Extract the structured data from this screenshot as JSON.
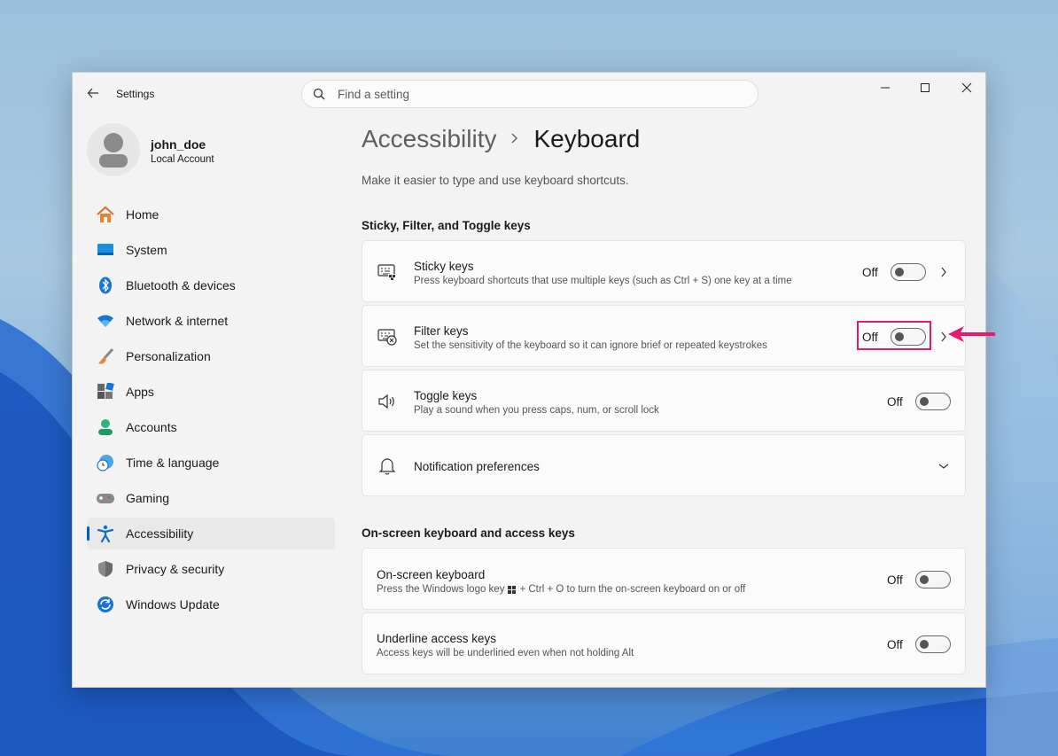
{
  "window": {
    "title": "Settings",
    "search_placeholder": "Find a setting"
  },
  "profile": {
    "name": "john_doe",
    "account_type": "Local Account"
  },
  "sidebar": {
    "items": [
      {
        "label": "Home",
        "icon": "home-icon"
      },
      {
        "label": "System",
        "icon": "system-icon"
      },
      {
        "label": "Bluetooth & devices",
        "icon": "bluetooth-icon"
      },
      {
        "label": "Network & internet",
        "icon": "wifi-icon"
      },
      {
        "label": "Personalization",
        "icon": "brush-icon"
      },
      {
        "label": "Apps",
        "icon": "apps-icon"
      },
      {
        "label": "Accounts",
        "icon": "accounts-icon"
      },
      {
        "label": "Time & language",
        "icon": "globe-clock-icon"
      },
      {
        "label": "Gaming",
        "icon": "gamepad-icon"
      },
      {
        "label": "Accessibility",
        "icon": "accessibility-icon",
        "active": true
      },
      {
        "label": "Privacy & security",
        "icon": "shield-icon"
      },
      {
        "label": "Windows Update",
        "icon": "update-icon"
      }
    ]
  },
  "page": {
    "breadcrumb_parent": "Accessibility",
    "breadcrumb_current": "Keyboard",
    "description": "Make it easier to type and use keyboard shortcuts."
  },
  "sections": [
    {
      "title": "Sticky, Filter, and Toggle keys",
      "settings": [
        {
          "title": "Sticky keys",
          "description": "Press keyboard shortcuts that use multiple keys (such as Ctrl + S) one key at a time",
          "state": "Off",
          "icon": "keyboard-sticky-icon"
        },
        {
          "title": "Filter keys",
          "description": "Set the sensitivity of the keyboard so it can ignore brief or repeated keystrokes",
          "state": "Off",
          "icon": "keyboard-filter-icon"
        },
        {
          "title": "Toggle keys",
          "description": "Play a sound when you press caps, num, or scroll lock",
          "state": "Off",
          "icon": "speaker-icon"
        },
        {
          "title": "Notification preferences",
          "icon": "bell-icon"
        }
      ]
    },
    {
      "title": "On-screen keyboard and access keys",
      "settings": [
        {
          "title": "On-screen keyboard",
          "description_before": "Press the Windows logo key",
          "description_after": "+ Ctrl + O to turn the on-screen keyboard on or off",
          "state": "Off"
        },
        {
          "title": "Underline access keys",
          "description": "Access keys will be underlined even when not holding Alt",
          "state": "Off"
        }
      ]
    }
  ],
  "colors": {
    "accent": "#005fb8",
    "highlight": "#e8196a"
  }
}
